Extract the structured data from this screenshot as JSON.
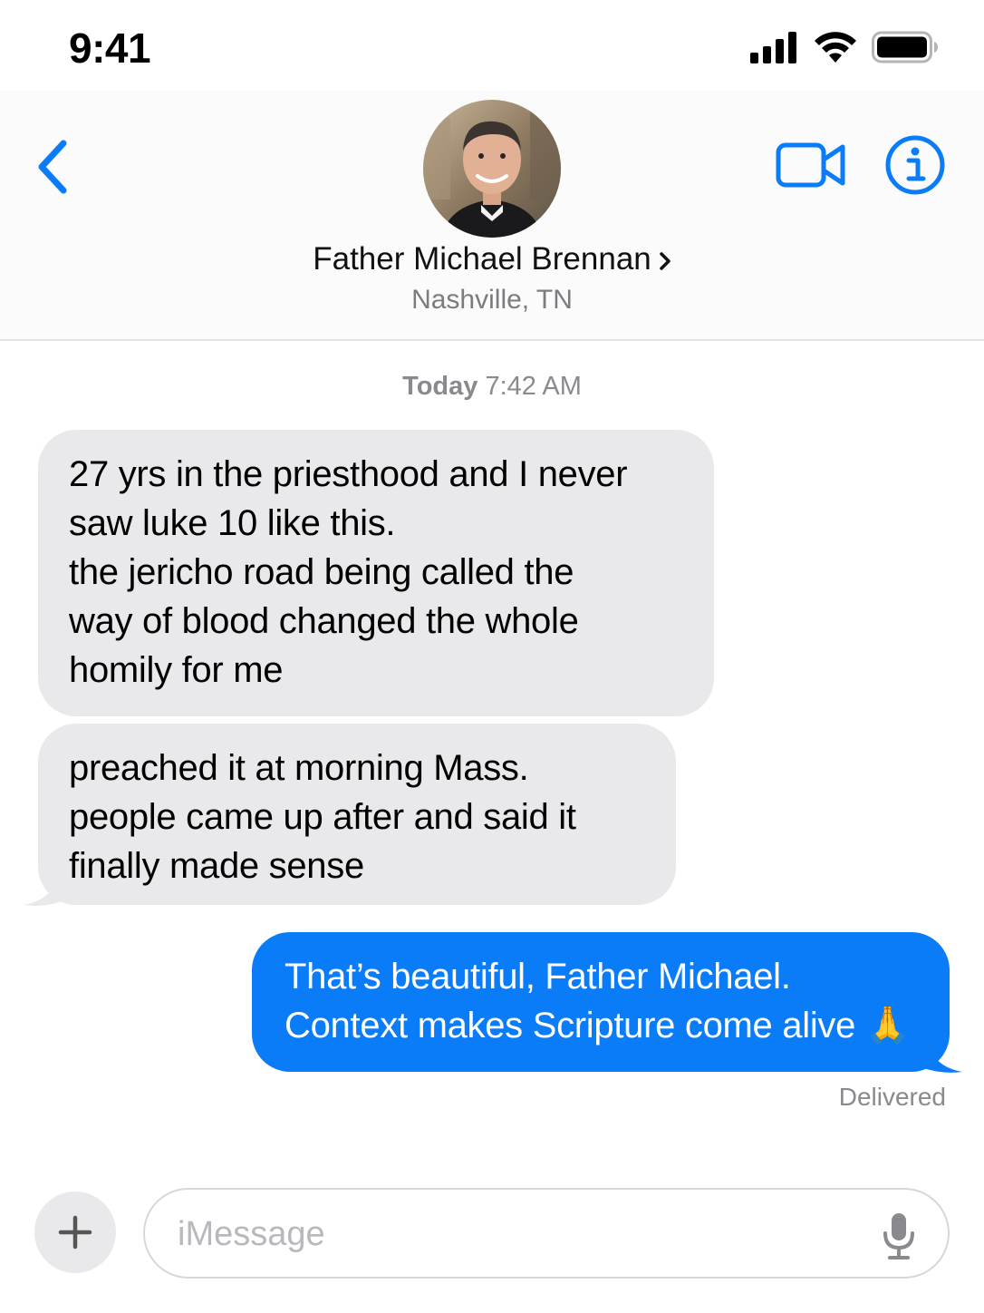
{
  "status_bar": {
    "time": "9:41"
  },
  "header": {
    "contact_name": "Father Michael Brennan",
    "contact_location": "Nashville, TN",
    "accent_color": "#0b7cf7"
  },
  "conversation": {
    "timestamp_day": "Today",
    "timestamp_time": "7:42 AM",
    "messages": [
      {
        "direction": "incoming",
        "text": "27 yrs in the priesthood and I never\nsaw luke 10 like this.\nthe jericho road being called the\nway of blood changed the whole\nhomily for me"
      },
      {
        "direction": "incoming",
        "text": "preached it at morning Mass.\npeople came up after and said it\nfinally made sense"
      },
      {
        "direction": "outgoing",
        "text": "That’s beautiful, Father Michael.\nContext makes Scripture come alive 🙏"
      }
    ],
    "delivery_status": "Delivered"
  },
  "composer": {
    "placeholder": "iMessage",
    "value": ""
  },
  "icons": {
    "back": "chevron-left-icon",
    "video": "video-camera-icon",
    "info": "info-icon",
    "plus": "plus-icon",
    "mic": "microphone-icon",
    "signal": "cellular-signal-icon",
    "wifi": "wifi-icon",
    "battery": "battery-icon"
  },
  "colors": {
    "incoming_bubble": "#e9e9eb",
    "outgoing_bubble": "#0b7cf7",
    "secondary_text": "#8a8a8e"
  }
}
